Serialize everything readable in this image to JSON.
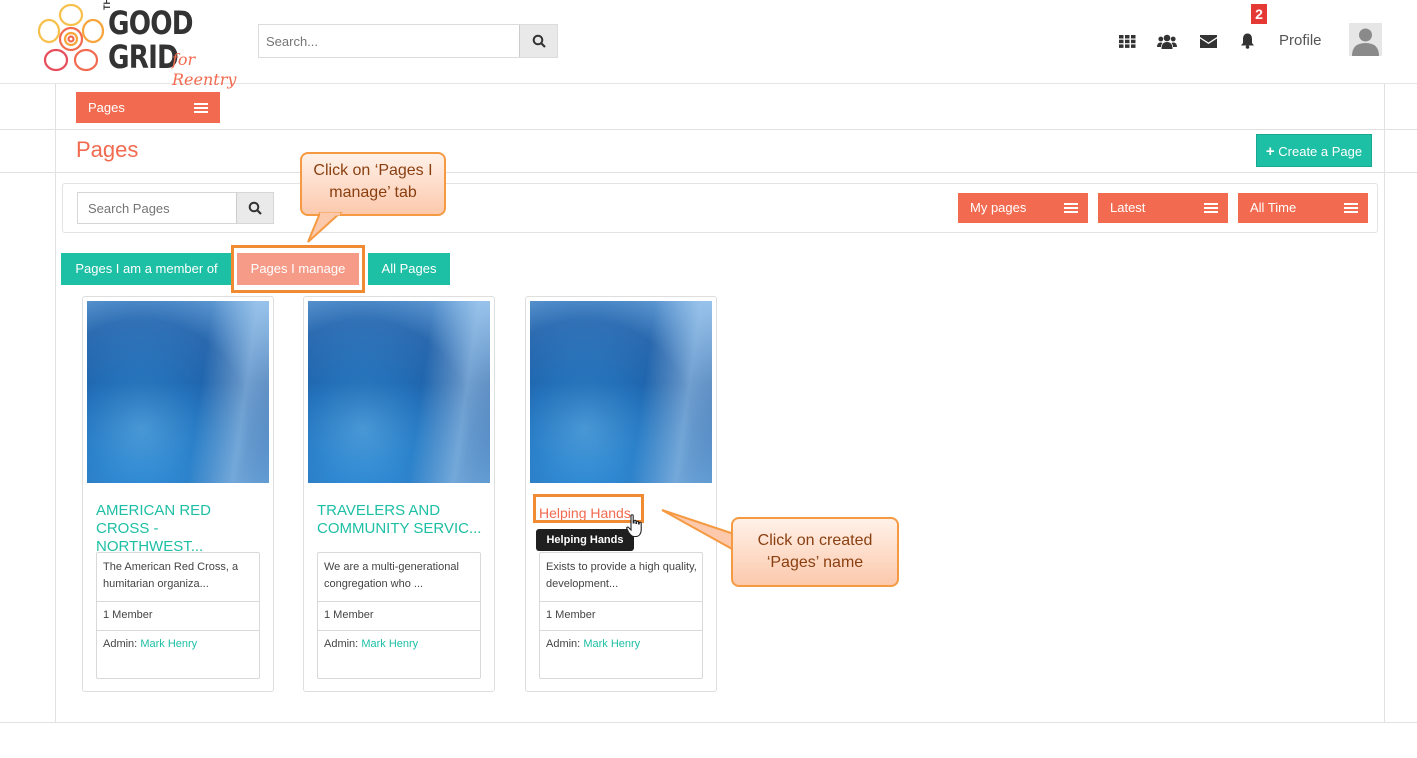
{
  "header": {
    "logo": {
      "line1": "GOOD",
      "line2": "GRID",
      "tagline": "for Reentry",
      "the": "THE"
    },
    "search_placeholder": "Search...",
    "notification_count": "2",
    "profile_label": "Profile",
    "icons": [
      "apps-grid-icon",
      "users-icon",
      "envelope-icon",
      "bell-icon"
    ]
  },
  "toolbar": {
    "pages_menu_label": "Pages",
    "page_title": "Pages",
    "create_button_label": "Create a Page"
  },
  "filters": {
    "search_placeholder": "Search Pages",
    "dropdowns": [
      "My pages",
      "Latest",
      "All Time"
    ]
  },
  "tabs": [
    "Pages I am a member of",
    "Pages I manage",
    "All Pages"
  ],
  "callouts": {
    "tab_hint": "Click on ‘Pages I manage’ tab",
    "name_hint": "Click on created ‘Pages’ name"
  },
  "cards": [
    {
      "name": "AMERICAN RED CROSS - NORTHWEST...",
      "description": "The American Red Cross, a humitarian organiza...",
      "members": "1 Member",
      "admin_label": "Admin:",
      "admin_name": "Mark Henry"
    },
    {
      "name": "TRAVELERS AND COMMUNITY SERVIC...",
      "description": "We are a multi-generational congregation who ...",
      "members": "1 Member",
      "admin_label": "Admin:",
      "admin_name": "Mark Henry"
    },
    {
      "name": "Helping Hands",
      "description": "Exists to provide a high quality, development...",
      "members": "1 Member",
      "admin_label": "Admin:",
      "admin_name": "Mark Henry"
    }
  ],
  "tooltip": "Helping Hands",
  "colors": {
    "accent": "#f26a4f",
    "teal": "#1dbfa5",
    "highlight": "#f08a33",
    "badge": "#e53935"
  }
}
